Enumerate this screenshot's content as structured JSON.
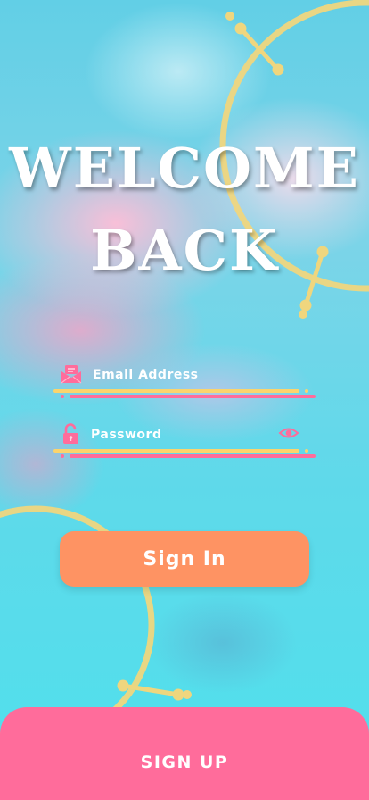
{
  "title": {
    "line1": "WELCOME",
    "line2": "BACK"
  },
  "form": {
    "email": {
      "placeholder": "Email Address",
      "icon": "envelope-icon"
    },
    "password": {
      "placeholder": "Password",
      "icon": "unlock-icon",
      "toggle_icon": "eye-icon"
    }
  },
  "buttons": {
    "sign_in": "Sign In",
    "sign_up": "SIGN UP"
  },
  "colors": {
    "primary_button": "#fe9363",
    "secondary_button": "#ff6c9b",
    "icon_pink": "#ff6c9b",
    "line_yellow": "#fbd46d",
    "decor_yellow": "#f2d37a",
    "text": "#ffffff"
  }
}
